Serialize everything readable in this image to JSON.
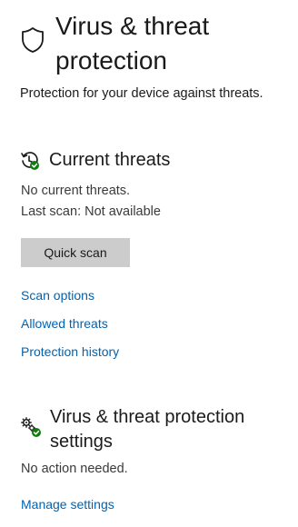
{
  "header": {
    "title": "Virus & threat protection",
    "icon": "shield-icon"
  },
  "subtitle": "Protection for your device against threats.",
  "current_threats": {
    "title": "Current threats",
    "icon": "threat-scan-history-icon",
    "status": "No current threats.",
    "last_scan": "Last scan: Not available",
    "quick_scan_label": "Quick scan",
    "links": {
      "scan_options": "Scan options",
      "allowed_threats": "Allowed threats",
      "protection_history": "Protection history"
    }
  },
  "settings": {
    "title": "Virus & threat protection settings",
    "icon": "settings-gears-check-icon",
    "status": "No action needed.",
    "manage_link": "Manage settings"
  },
  "colors": {
    "link": "#0063b1",
    "button_bg": "#cccccc",
    "status_ok": "#107c10"
  }
}
